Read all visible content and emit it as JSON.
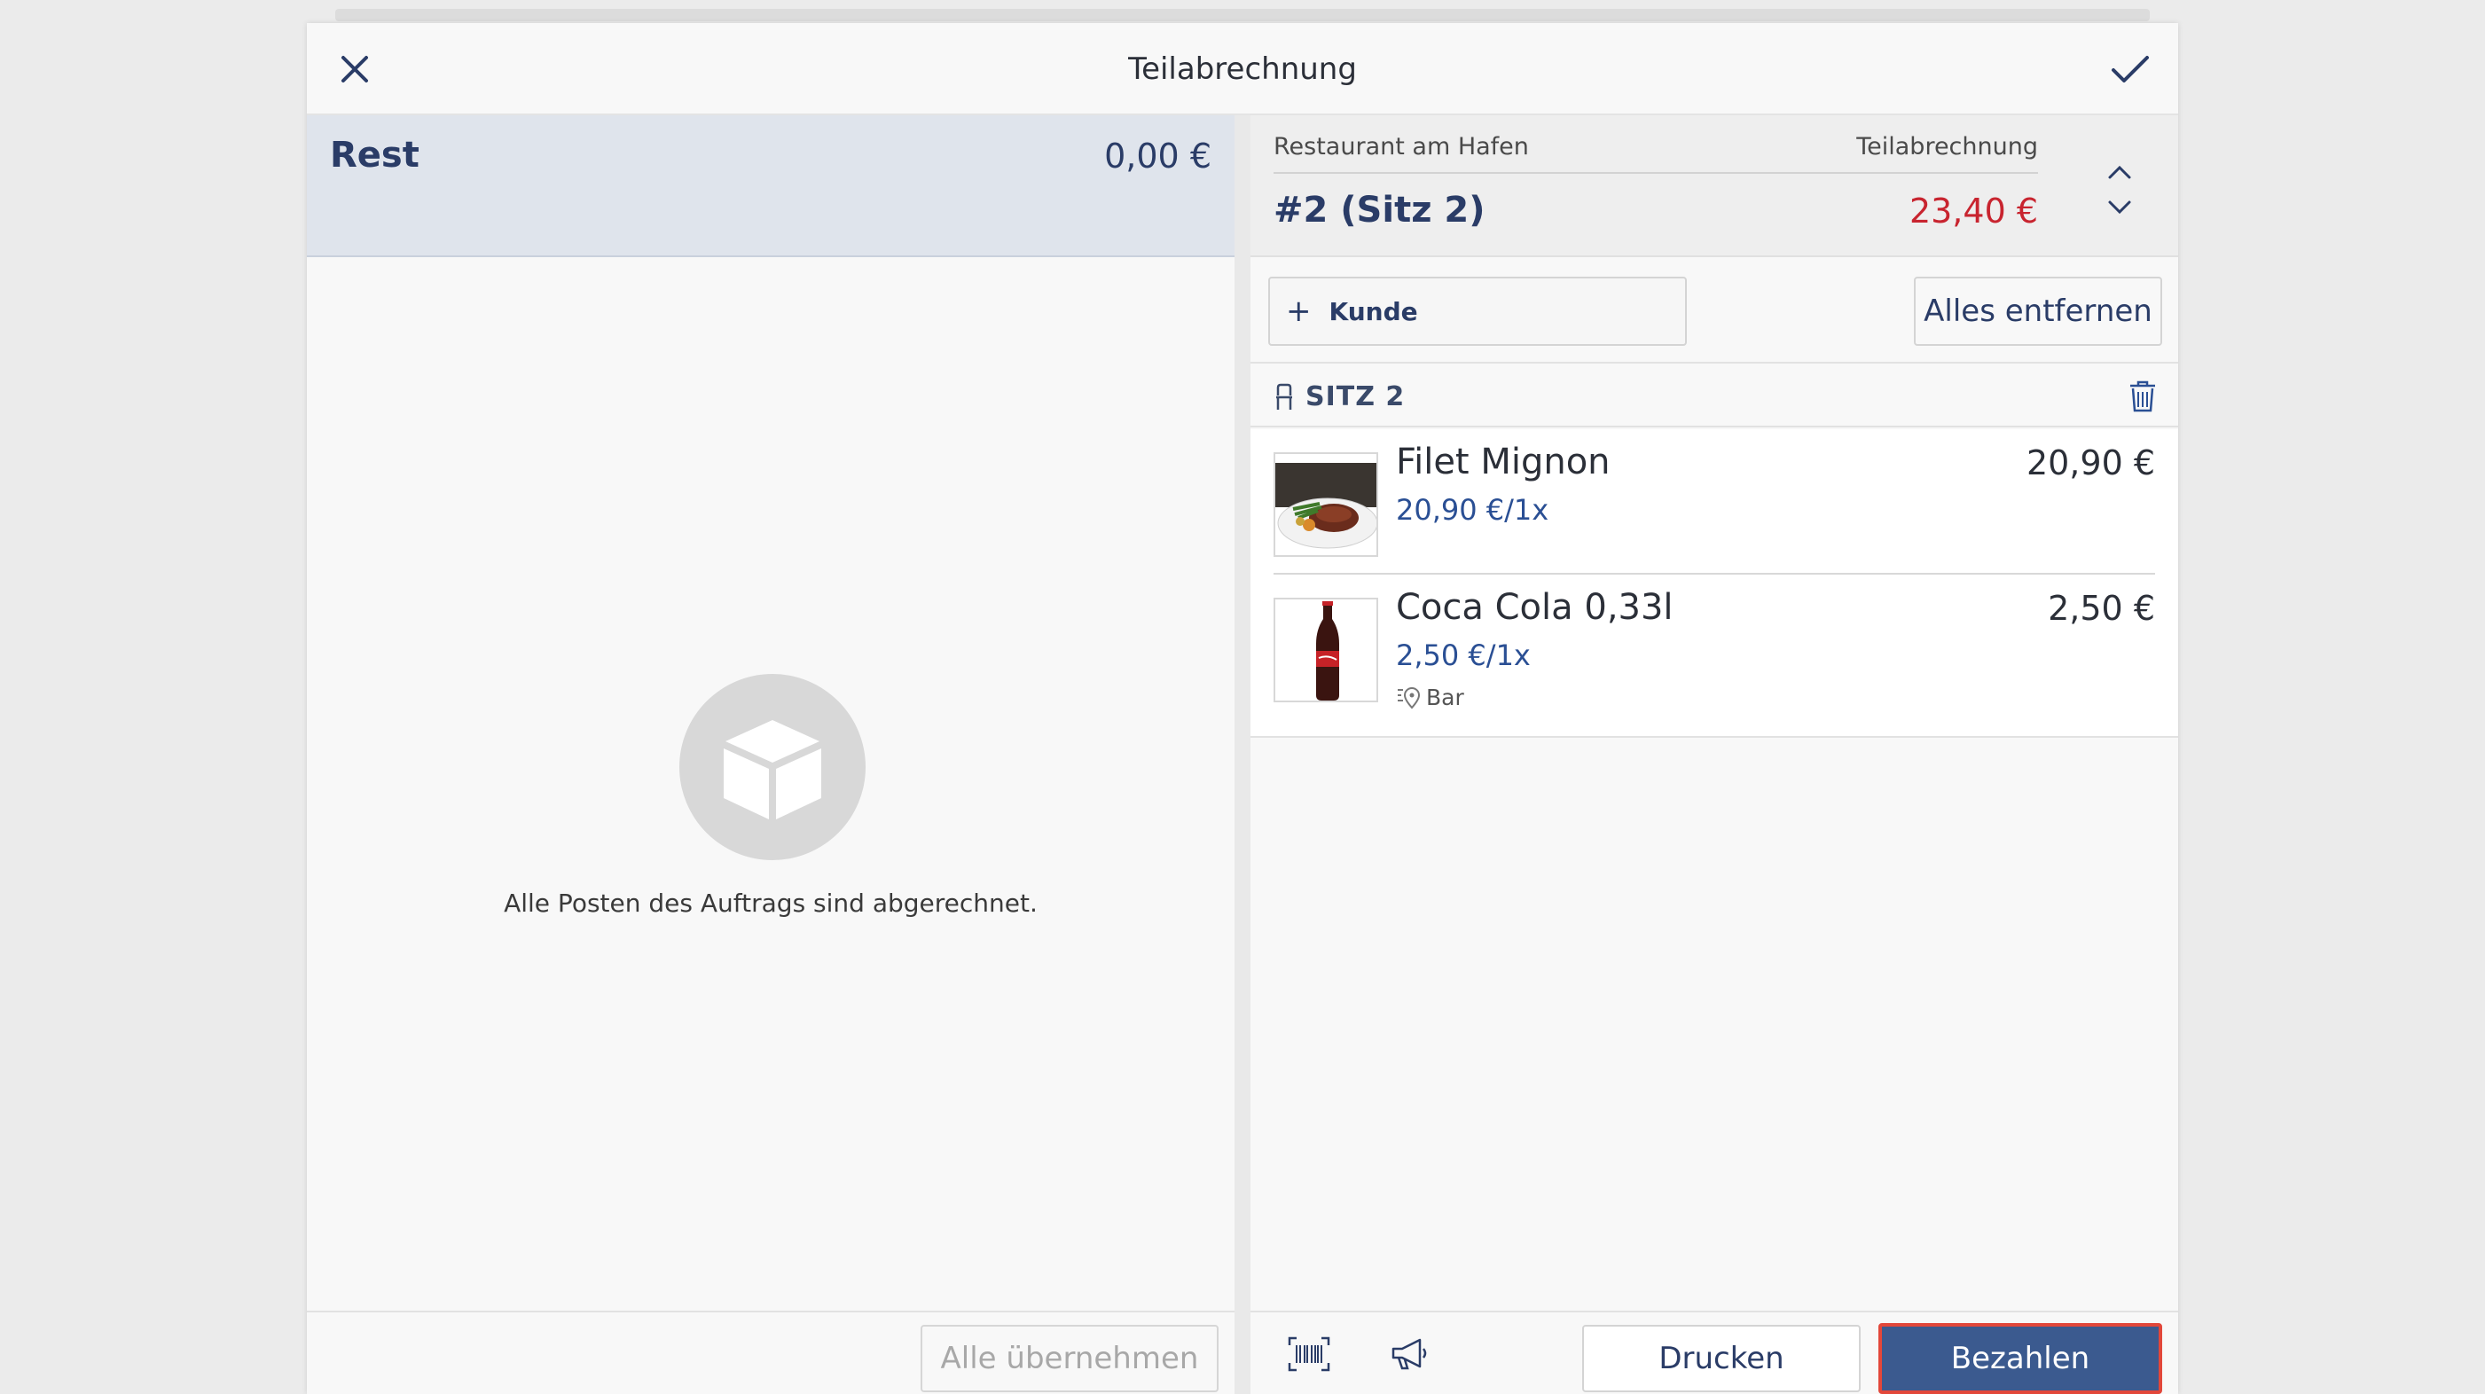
{
  "dialog": {
    "title": "Teilabrechnung",
    "close_icon": "close-icon",
    "confirm_icon": "check-icon"
  },
  "left": {
    "rest_label": "Rest",
    "rest_value": "0,00 €",
    "empty_icon": "box-icon",
    "empty_text": "Alle Posten des Auftrags sind abgerechnet.",
    "take_all_label": "Alle übernehmen"
  },
  "right": {
    "venue": "Restaurant am Hafen",
    "split_label": "Teilabrechnung",
    "order_name": "#2 (Sitz 2)",
    "order_total": "23,40 €",
    "customer_label": "Kunde",
    "remove_all_label": "Alles entfernen",
    "seat_label": "SITZ 2",
    "items": [
      {
        "name": "Filet Mignon",
        "unit": "20,90 €/1x",
        "price": "20,90 €",
        "station": ""
      },
      {
        "name": "Coca Cola 0,33l",
        "unit": "2,50 €/1x",
        "price": "2,50 €",
        "station": "Bar"
      }
    ],
    "print_label": "Drucken",
    "pay_label": "Bezahlen"
  },
  "colors": {
    "accent": "#3b5a8f",
    "total_red": "#c8242f",
    "highlight_border": "#e2473a"
  }
}
